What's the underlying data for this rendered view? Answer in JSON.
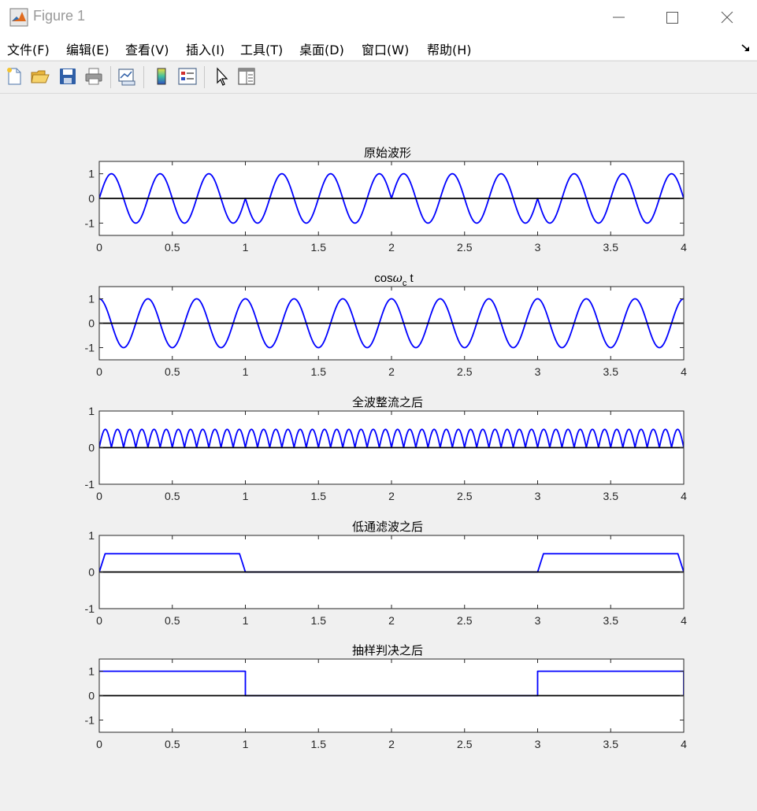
{
  "window": {
    "title": "Figure 1",
    "icon": "matlab-logo-icon",
    "controls": [
      "minimize-icon",
      "maximize-icon",
      "close-icon"
    ]
  },
  "menu": {
    "items": [
      "文件(F)",
      "编辑(E)",
      "查看(V)",
      "插入(I)",
      "工具(T)",
      "桌面(D)",
      "窗口(W)",
      "帮助(H)"
    ]
  },
  "toolbar": {
    "buttons": [
      "new-figure-icon",
      "open-file-icon",
      "save-icon",
      "print-icon",
      "link-plot-icon",
      "insert-colorbar-icon",
      "insert-legend-icon",
      "edit-plot-arrow-icon",
      "property-inspector-icon"
    ]
  },
  "colors": {
    "line": "#0000ff",
    "zero_line": "#000000",
    "axes_bg": "#ffffff",
    "figure_bg": "#f0f0f0"
  },
  "chart_data": [
    {
      "type": "line",
      "title": "原始波形",
      "xlim": [
        0,
        4
      ],
      "ylim": [
        -1.5,
        1.5
      ],
      "xticks": [
        0,
        0.5,
        1,
        1.5,
        2,
        2.5,
        3,
        3.5,
        4
      ],
      "xtick_labels": [
        "0",
        "0.5",
        "1",
        "1.5",
        "2",
        "2.5",
        "3",
        "3.5",
        "4"
      ],
      "yticks": [
        1,
        0,
        -1
      ],
      "ytick_labels": [
        "1",
        "0",
        "-1"
      ],
      "series": [
        {
          "expression": "sin(2π·3·t)·s(t)",
          "bits": [
            1,
            -1,
            1,
            -1
          ],
          "bit_duration": 1,
          "carrier_freq": 3
        },
        {
          "expression": "y = 0",
          "constant": 0
        }
      ]
    },
    {
      "type": "line",
      "title": "cosωc t",
      "xlim": [
        0,
        4
      ],
      "ylim": [
        -1.5,
        1.5
      ],
      "xticks": [
        0,
        0.5,
        1,
        1.5,
        2,
        2.5,
        3,
        3.5,
        4
      ],
      "xtick_labels": [
        "0",
        "0.5",
        "1",
        "1.5",
        "2",
        "2.5",
        "3",
        "3.5",
        "4"
      ],
      "yticks": [
        1,
        0,
        -1
      ],
      "ytick_labels": [
        "1",
        "0",
        "-1"
      ],
      "series": [
        {
          "expression": "cos(2π·3·t)",
          "carrier_freq": 3
        },
        {
          "expression": "y = 0",
          "constant": 0
        }
      ]
    },
    {
      "type": "line",
      "title": "全波整流之后",
      "xlim": [
        0,
        4
      ],
      "ylim": [
        -1,
        1
      ],
      "xticks": [
        0,
        0.5,
        1,
        1.5,
        2,
        2.5,
        3,
        3.5,
        4
      ],
      "xtick_labels": [
        "0",
        "0.5",
        "1",
        "1.5",
        "2",
        "2.5",
        "3",
        "3.5",
        "4"
      ],
      "yticks": [
        1,
        0,
        -1
      ],
      "ytick_labels": [
        "1",
        "0",
        "-1"
      ],
      "series": [
        {
          "expression": "|sin(2π·6·t)|·0.5",
          "peak": 0.5,
          "freq": 6
        },
        {
          "expression": "y = 0",
          "constant": 0
        }
      ]
    },
    {
      "type": "line",
      "title": "低通滤波之后",
      "xlim": [
        0,
        4
      ],
      "ylim": [
        -1,
        1
      ],
      "xticks": [
        0,
        0.5,
        1,
        1.5,
        2,
        2.5,
        3,
        3.5,
        4
      ],
      "xtick_labels": [
        "0",
        "0.5",
        "1",
        "1.5",
        "2",
        "2.5",
        "3",
        "3.5",
        "4"
      ],
      "yticks": [
        1,
        0,
        -1
      ],
      "ytick_labels": [
        "1",
        "0",
        "-1"
      ],
      "series": [
        {
          "expression": "filtered envelope",
          "points": [
            [
              0,
              0
            ],
            [
              0.04,
              0.5
            ],
            [
              0.96,
              0.5
            ],
            [
              1.0,
              0
            ],
            [
              3.0,
              0
            ],
            [
              3.04,
              0.5
            ],
            [
              3.96,
              0.5
            ],
            [
              4.0,
              0
            ]
          ]
        },
        {
          "expression": "y = 0",
          "constant": 0
        }
      ]
    },
    {
      "type": "line",
      "title": "抽样判决之后",
      "xlim": [
        0,
        4
      ],
      "ylim": [
        -1.5,
        1.5
      ],
      "xticks": [
        0,
        0.5,
        1,
        1.5,
        2,
        2.5,
        3,
        3.5,
        4
      ],
      "xtick_labels": [
        "0",
        "0.5",
        "1",
        "1.5",
        "2",
        "2.5",
        "3",
        "3.5",
        "4"
      ],
      "yticks": [
        1,
        0,
        -1
      ],
      "ytick_labels": [
        "1",
        "0",
        "-1"
      ],
      "series": [
        {
          "expression": "decision output",
          "points": [
            [
              0,
              1
            ],
            [
              1,
              1
            ],
            [
              1,
              0
            ],
            [
              3,
              0
            ],
            [
              3,
              1
            ],
            [
              4,
              1
            ],
            [
              4,
              0
            ]
          ]
        },
        {
          "expression": "y = 0",
          "constant": 0
        }
      ]
    }
  ]
}
